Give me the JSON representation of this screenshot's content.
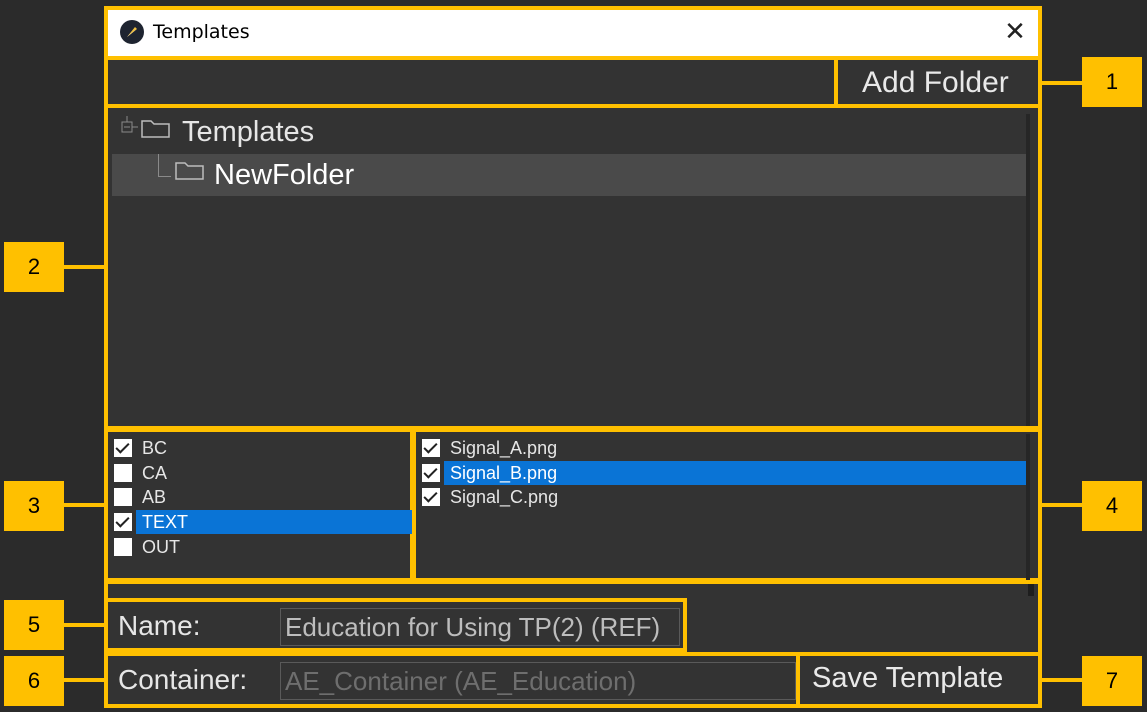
{
  "window": {
    "title": "Templates",
    "close_glyph": "✕"
  },
  "toolbar": {
    "add_folder_label": "Add Folder"
  },
  "tree": {
    "root_label": "Templates",
    "child_label": "NewFolder"
  },
  "layers": [
    {
      "label": "BC",
      "checked": true,
      "selected": false
    },
    {
      "label": "CA",
      "checked": false,
      "selected": false
    },
    {
      "label": "AB",
      "checked": false,
      "selected": false
    },
    {
      "label": "TEXT",
      "checked": true,
      "selected": true
    },
    {
      "label": "OUT",
      "checked": false,
      "selected": false
    }
  ],
  "files": [
    {
      "label": "Signal_A.png",
      "checked": true,
      "selected": false
    },
    {
      "label": "Signal_B.png",
      "checked": true,
      "selected": true
    },
    {
      "label": "Signal_C.png",
      "checked": true,
      "selected": false
    }
  ],
  "form": {
    "name_label": "Name:",
    "name_value": "Education for Using TP(2) (REF)",
    "container_label": "Container:",
    "container_value": "AE_Container (AE_Education)",
    "save_label": "Save Template"
  },
  "callouts": {
    "c1": "1",
    "c2": "2",
    "c3": "3",
    "c4": "4",
    "c5": "5",
    "c6": "6",
    "c7": "7"
  },
  "colors": {
    "highlight": "#ffc000",
    "selection": "#0a74d6",
    "background": "#333333"
  }
}
